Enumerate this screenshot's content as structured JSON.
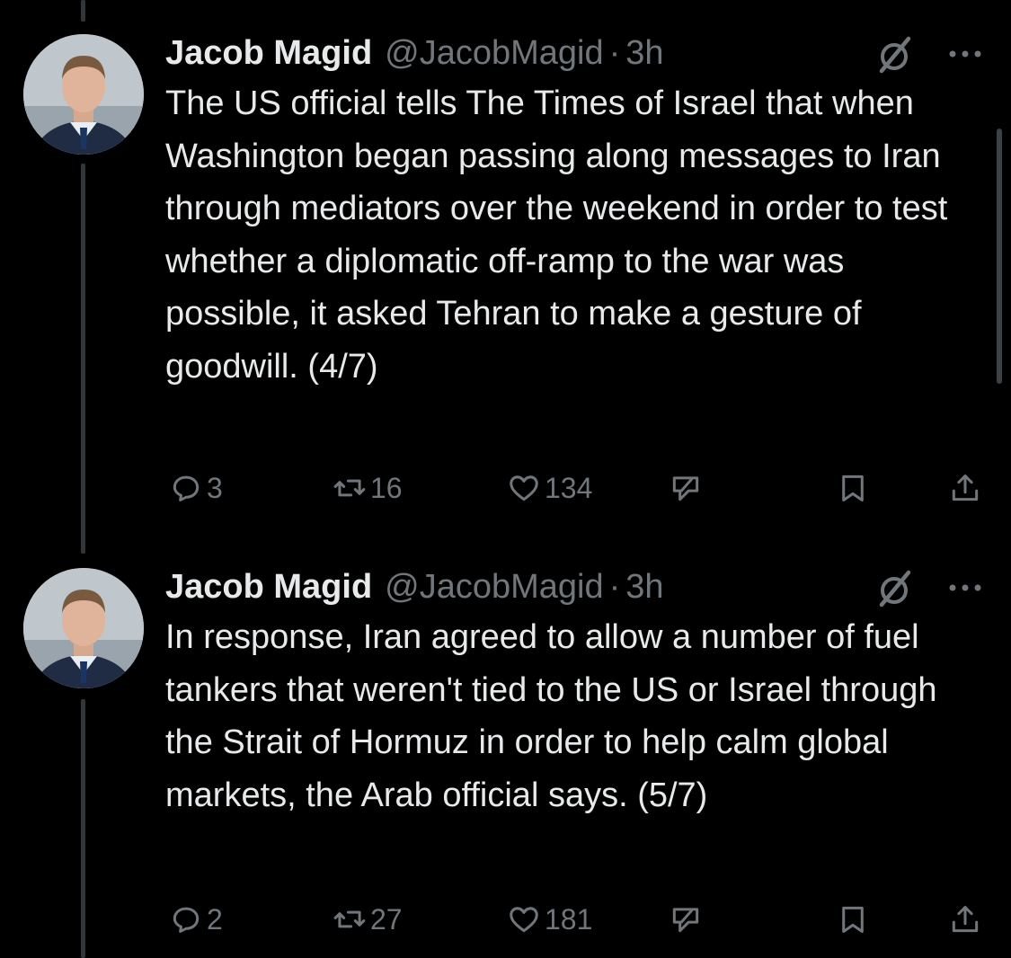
{
  "tweets": [
    {
      "author_name": "Jacob Magid",
      "handle": "@JacobMagid",
      "separator": "·",
      "time": "3h",
      "text": "The US official tells The Times of Israel that when Washington began passing along messages to Iran through mediators over the weekend in order to test whether a diplomatic off-ramp to the war was possible, it asked Tehran to make a gesture of goodwill. (4/7)",
      "replies": "3",
      "reposts": "16",
      "likes": "134"
    },
    {
      "author_name": "Jacob Magid",
      "handle": "@JacobMagid",
      "separator": "·",
      "time": "3h",
      "text": "In response, Iran agreed to allow a number of fuel tankers that weren't tied to the US or Israel through the Strait of Hormuz in order to help calm global markets, the Arab official says. (5/7)",
      "replies": "2",
      "reposts": "27",
      "likes": "181"
    }
  ],
  "colors": {
    "background": "#000000",
    "primary_text": "#e7e9ea",
    "secondary_text": "#71767b",
    "thread_line": "#333639"
  },
  "icons": [
    "reply-icon",
    "repost-icon",
    "like-icon",
    "grok-icon",
    "bookmark-icon",
    "share-icon",
    "more-icon"
  ]
}
